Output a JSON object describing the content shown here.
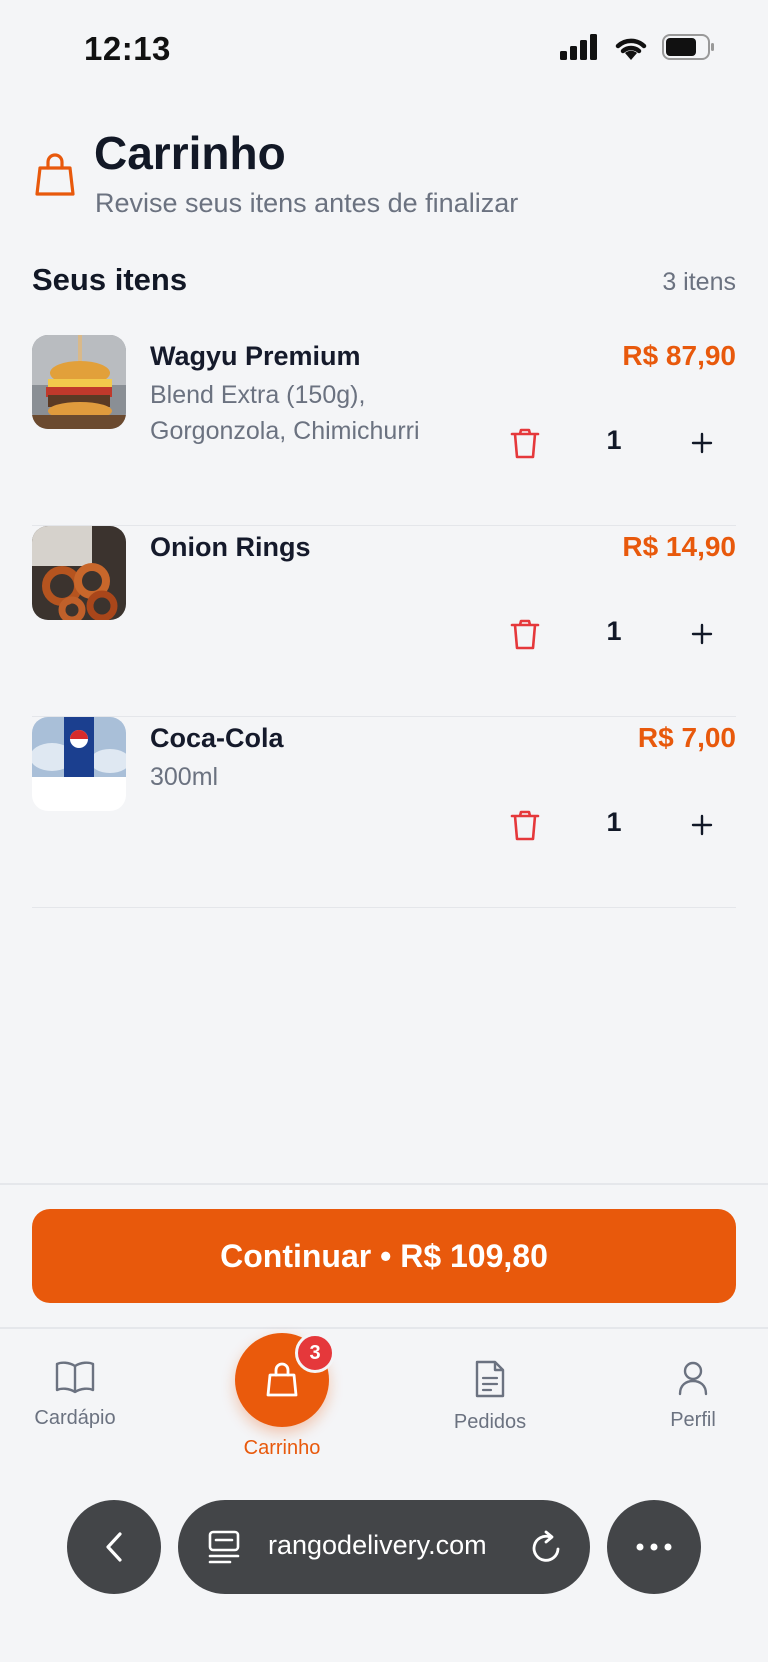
{
  "status_bar": {
    "time": "12:13"
  },
  "header": {
    "title": "Carrinho",
    "subtitle": "Revise seus itens antes de finalizar"
  },
  "section": {
    "title": "Seus itens",
    "count": "3 itens"
  },
  "items": [
    {
      "name": "Wagyu Premium",
      "description": "Blend Extra (150g), Gorgonzola, Chimichurri",
      "price": "R$ 87,90",
      "quantity": "1",
      "image": "burger-image"
    },
    {
      "name": "Onion Rings",
      "description": "",
      "price": "R$ 14,90",
      "quantity": "1",
      "image": "onion-rings-image"
    },
    {
      "name": "Coca-Cola",
      "description": "300ml",
      "price": "R$ 7,00",
      "quantity": "1",
      "image": "soda-can-image"
    }
  ],
  "checkout": {
    "label": "Continuar • R$ 109,80"
  },
  "nav": {
    "items": [
      {
        "label": "Cardápio",
        "icon": "book-icon"
      },
      {
        "label": "Carrinho",
        "icon": "bag-icon",
        "badge": "3",
        "active": true
      },
      {
        "label": "Pedidos",
        "icon": "document-icon"
      },
      {
        "label": "Perfil",
        "icon": "user-icon"
      }
    ]
  },
  "browser": {
    "url": "rangodelivery.com"
  },
  "colors": {
    "accent": "#e8590c",
    "danger": "#e5383b",
    "text": "#121826",
    "muted": "#6b7280"
  }
}
